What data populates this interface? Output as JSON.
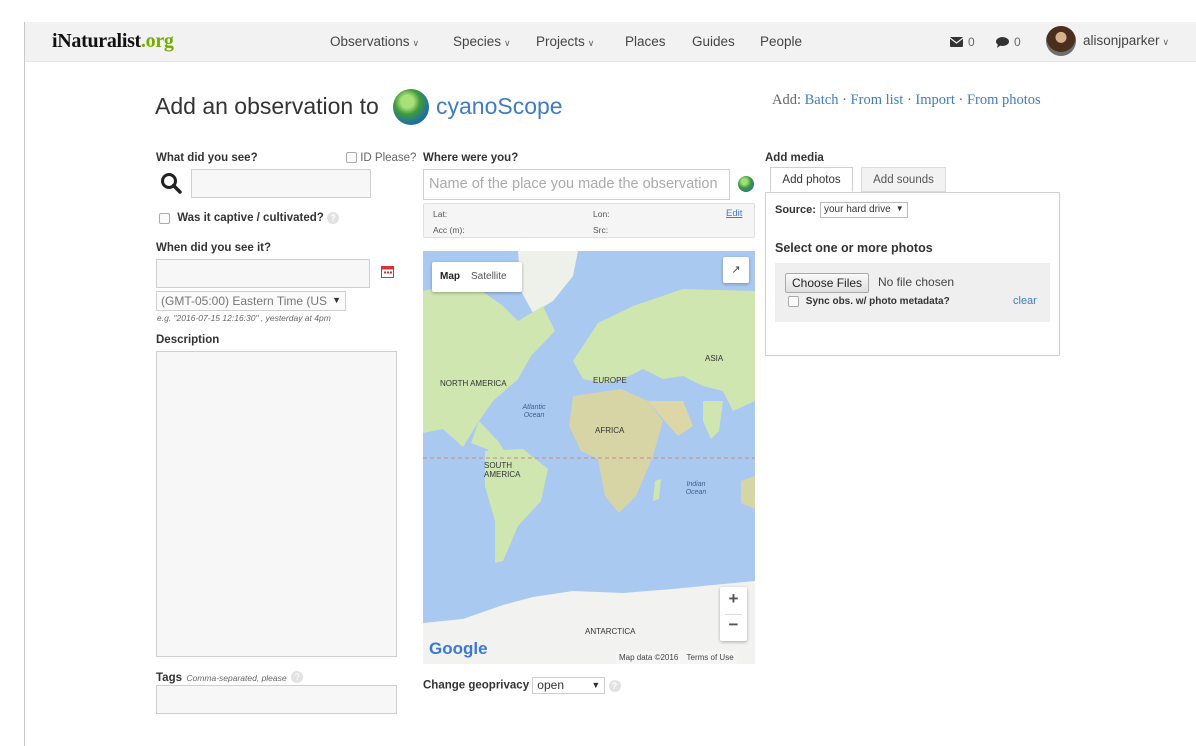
{
  "nav": {
    "logo_main": "iNaturalist",
    "logo_accent": ".org",
    "items": [
      {
        "label": "Observations",
        "dropdown": true
      },
      {
        "label": "Species",
        "dropdown": true
      },
      {
        "label": "Projects",
        "dropdown": true
      },
      {
        "label": "Places",
        "dropdown": false
      },
      {
        "label": "Guides",
        "dropdown": false
      },
      {
        "label": "People",
        "dropdown": false
      }
    ],
    "messages_count": "0",
    "notifications_count": "0",
    "username": "alisonjparker"
  },
  "header": {
    "title": "Add an observation to",
    "project_name": "cyanoScope",
    "add_prefix": "Add:",
    "add_links": [
      "Batch",
      "From list",
      "Import",
      "From photos"
    ],
    "separator": "·"
  },
  "form": {
    "what_label": "What did you see?",
    "id_please_label": "ID Please?",
    "species_value": "",
    "captive_label": "Was it captive / cultivated?",
    "when_label": "When did you see it?",
    "date_value": "",
    "timezone_value": "(GMT-05:00) Eastern Time (US",
    "date_hint": "e.g. \"2016-07-15 12:16:30\" , yesterday at 4pm",
    "description_label": "Description",
    "description_value": "",
    "tags_label": "Tags",
    "tags_hint": "Comma-separated, please",
    "tags_value": ""
  },
  "location": {
    "label": "Where were you?",
    "place_placeholder": "Name of the place you made the observation",
    "lat_label": "Lat:",
    "lon_label": "Lon:",
    "acc_label": "Acc (m):",
    "src_label": "Src:",
    "edit_label": "Edit",
    "map_type_map": "Map",
    "map_type_satellite": "Satellite",
    "map_labels": {
      "north_america": "NORTH AMERICA",
      "europe": "EUROPE",
      "asia": "ASIA",
      "africa": "AFRICA",
      "south_america": "SOUTH AMERICA",
      "antarctica": "ANTARCTICA",
      "atlantic": "Atlantic Ocean",
      "indian": "Indian Ocean"
    },
    "zoom_in": "+",
    "zoom_out": "−",
    "google_label": "Google",
    "map_data": "Map data ©2016",
    "terms": "Terms of Use",
    "geoprivacy_label": "Change geoprivacy",
    "geoprivacy_value": "open"
  },
  "media": {
    "label": "Add media",
    "tab_photos": "Add photos",
    "tab_sounds": "Add sounds",
    "source_label": "Source:",
    "source_value": "your hard drive",
    "select_title": "Select one or more photos",
    "choose_files": "Choose Files",
    "no_file": "No file chosen",
    "sync_label": "Sync obs. w/ photo metadata?",
    "clear_label": "clear"
  },
  "colors": {
    "brand_green": "#74ac00",
    "link_blue": "#3f7cc4",
    "map_water": "#a9c9f0",
    "map_land": "#cfe6b0"
  }
}
